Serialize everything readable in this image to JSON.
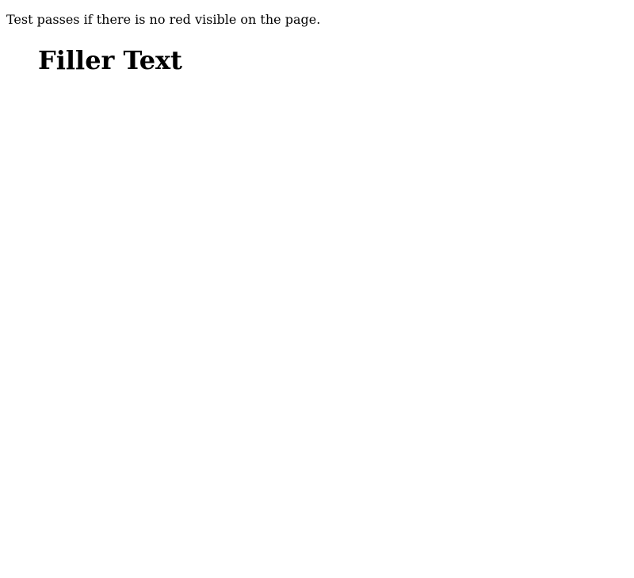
{
  "page": {
    "instruction": "Test passes if there is no red visible on the page.",
    "heading": "Filler Text"
  }
}
